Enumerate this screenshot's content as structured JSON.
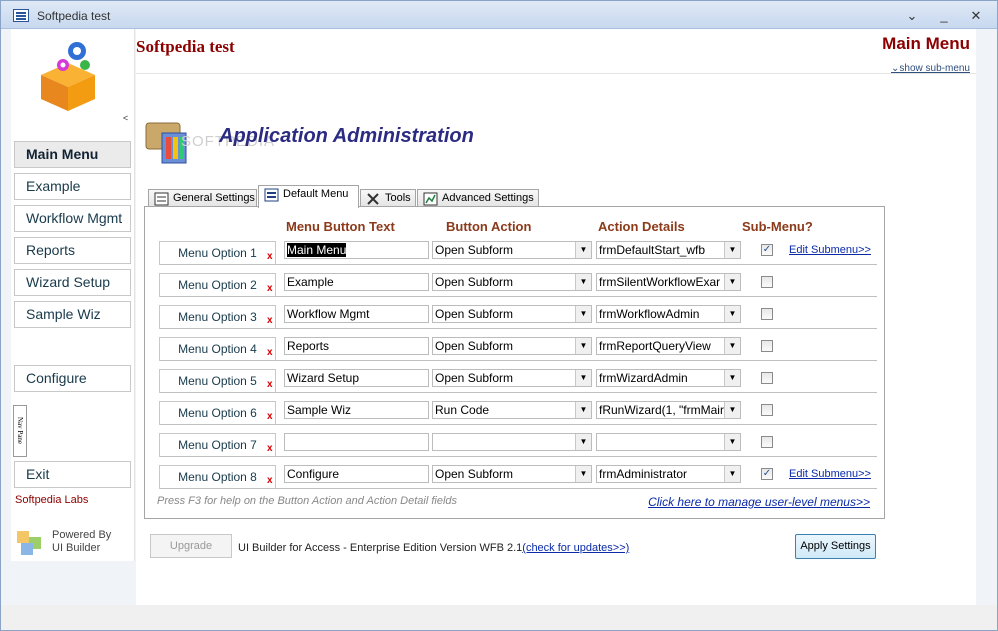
{
  "window": {
    "title": "Softpedia test"
  },
  "sidebar": {
    "collapse_glyph": "<",
    "items": [
      {
        "label": "Main Menu"
      },
      {
        "label": "Example"
      },
      {
        "label": "Workflow Mgmt"
      },
      {
        "label": "Reports"
      },
      {
        "label": "Wizard Setup"
      },
      {
        "label": "Sample Wiz"
      },
      {
        "label": "Configure"
      },
      {
        "label": "Exit"
      }
    ],
    "nav_pane_label": "Nav Pane",
    "labs_text": "Softpedia Labs",
    "powered_by_line1": "Powered By",
    "powered_by_line2": "UI Builder"
  },
  "header": {
    "app_title": "Softpedia test",
    "page_title": "Main Menu",
    "show_sub_menu": "show sub-menu",
    "section_title": "Application Administration",
    "watermark": "SOFTPEDIA"
  },
  "tabs": [
    {
      "label": "General Settings"
    },
    {
      "label": "Default Menu"
    },
    {
      "label": "Tools"
    },
    {
      "label": "Advanced Settings"
    }
  ],
  "columns": {
    "button_text": "Menu Button Text",
    "button_action": "Button Action",
    "action_details": "Action Details",
    "sub_menu": "Sub-Menu?"
  },
  "rows": [
    {
      "option": "Menu Option 1",
      "x": "x",
      "text": "Main Menu",
      "action": "Open Subform",
      "details": "frmDefaultStart_wfb",
      "sub": "✓",
      "edit": "Edit Submenu>>"
    },
    {
      "option": "Menu Option 2",
      "x": "x",
      "text": "Example",
      "action": "Open Subform",
      "details": "frmSilentWorkflowExar",
      "sub": "",
      "edit": ""
    },
    {
      "option": "Menu Option 3",
      "x": "x",
      "text": "Workflow Mgmt",
      "action": "Open Subform",
      "details": "frmWorkflowAdmin",
      "sub": "",
      "edit": ""
    },
    {
      "option": "Menu Option 4",
      "x": "x",
      "text": "Reports",
      "action": "Open Subform",
      "details": "frmReportQueryView",
      "sub": "",
      "edit": ""
    },
    {
      "option": "Menu Option 5",
      "x": "x",
      "text": "Wizard Setup",
      "action": "Open Subform",
      "details": "frmWizardAdmin",
      "sub": "",
      "edit": ""
    },
    {
      "option": "Menu Option 6",
      "x": "x",
      "text": "Sample Wiz",
      "action": "Run Code",
      "details": "fRunWizard(1, \"frmMair",
      "sub": "",
      "edit": ""
    },
    {
      "option": "Menu Option 7",
      "x": "x",
      "text": "",
      "action": "",
      "details": "",
      "sub": "",
      "edit": ""
    },
    {
      "option": "Menu Option 8",
      "x": "x",
      "text": "Configure",
      "action": "Open Subform",
      "details": "frmAdministrator",
      "sub": "✓",
      "edit": "Edit Submenu>>"
    }
  ],
  "footer": {
    "help_text": "Press F3 for help on the Button Action and Action Detail fields",
    "manage_link": "Click here to manage user-level menus>>",
    "upgrade": "Upgrade",
    "version": "UI Builder for Access - Enterprise Edition Version  WFB 2.1",
    "check_updates": "(check for updates>>)",
    "apply": "Apply Settings"
  },
  "colors": {
    "accent": "#8b0000",
    "title_blue": "#2b2b82",
    "link": "#0a2aa8"
  }
}
